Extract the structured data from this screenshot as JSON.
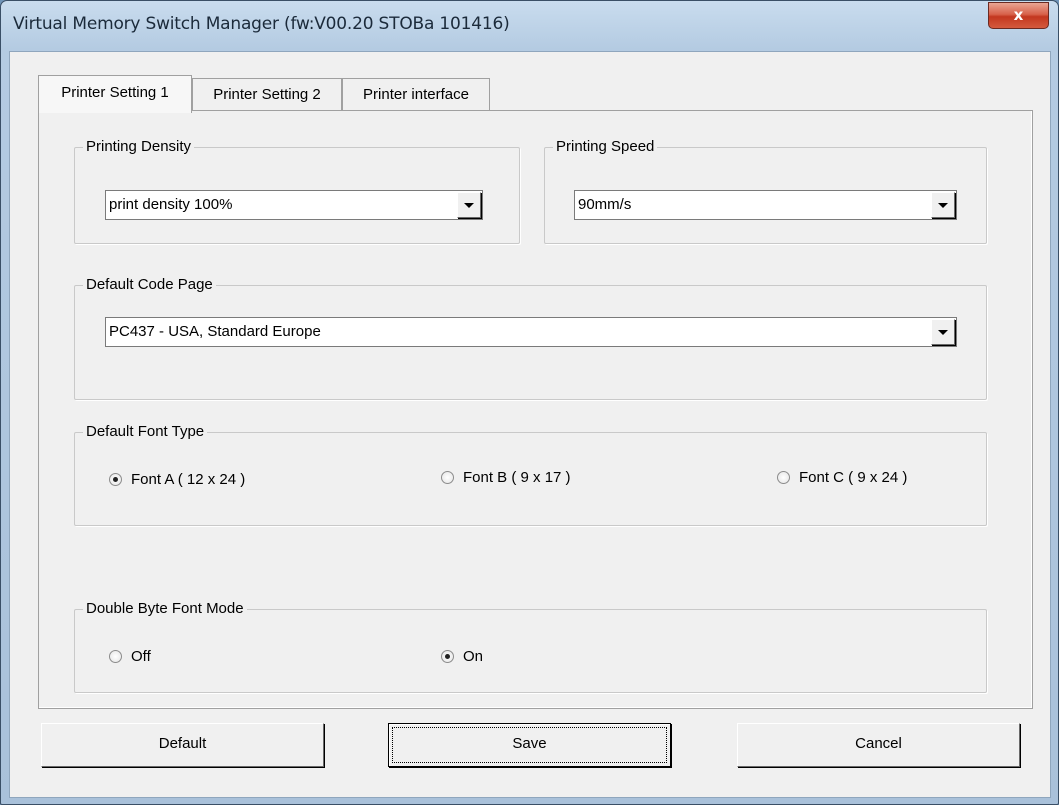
{
  "window": {
    "title": "Virtual Memory Switch Manager  (fw:V00.20 STOBa 101416)",
    "close_label": "x"
  },
  "tabs": [
    {
      "label": "Printer Setting 1",
      "active": true
    },
    {
      "label": "Printer Setting 2",
      "active": false
    },
    {
      "label": "Printer interface",
      "active": false
    }
  ],
  "printing_density": {
    "group_title": "Printing Density",
    "selected": "print density 100%"
  },
  "printing_speed": {
    "group_title": "Printing Speed",
    "selected": "90mm/s"
  },
  "code_page": {
    "group_title": "Default Code Page",
    "selected": "PC437 - USA, Standard Europe"
  },
  "font_type": {
    "group_title": "Default Font Type",
    "options": [
      {
        "label": "Font A ( 12 x 24 )",
        "checked": true
      },
      {
        "label": "Font B ( 9 x 17 )",
        "checked": false
      },
      {
        "label": "Font C ( 9 x 24 )",
        "checked": false
      }
    ]
  },
  "double_byte": {
    "group_title": "Double Byte Font Mode",
    "options": [
      {
        "label": "Off",
        "checked": false
      },
      {
        "label": "On",
        "checked": true
      }
    ]
  },
  "buttons": {
    "default_label": "Default",
    "save_label": "Save",
    "cancel_label": "Cancel"
  }
}
